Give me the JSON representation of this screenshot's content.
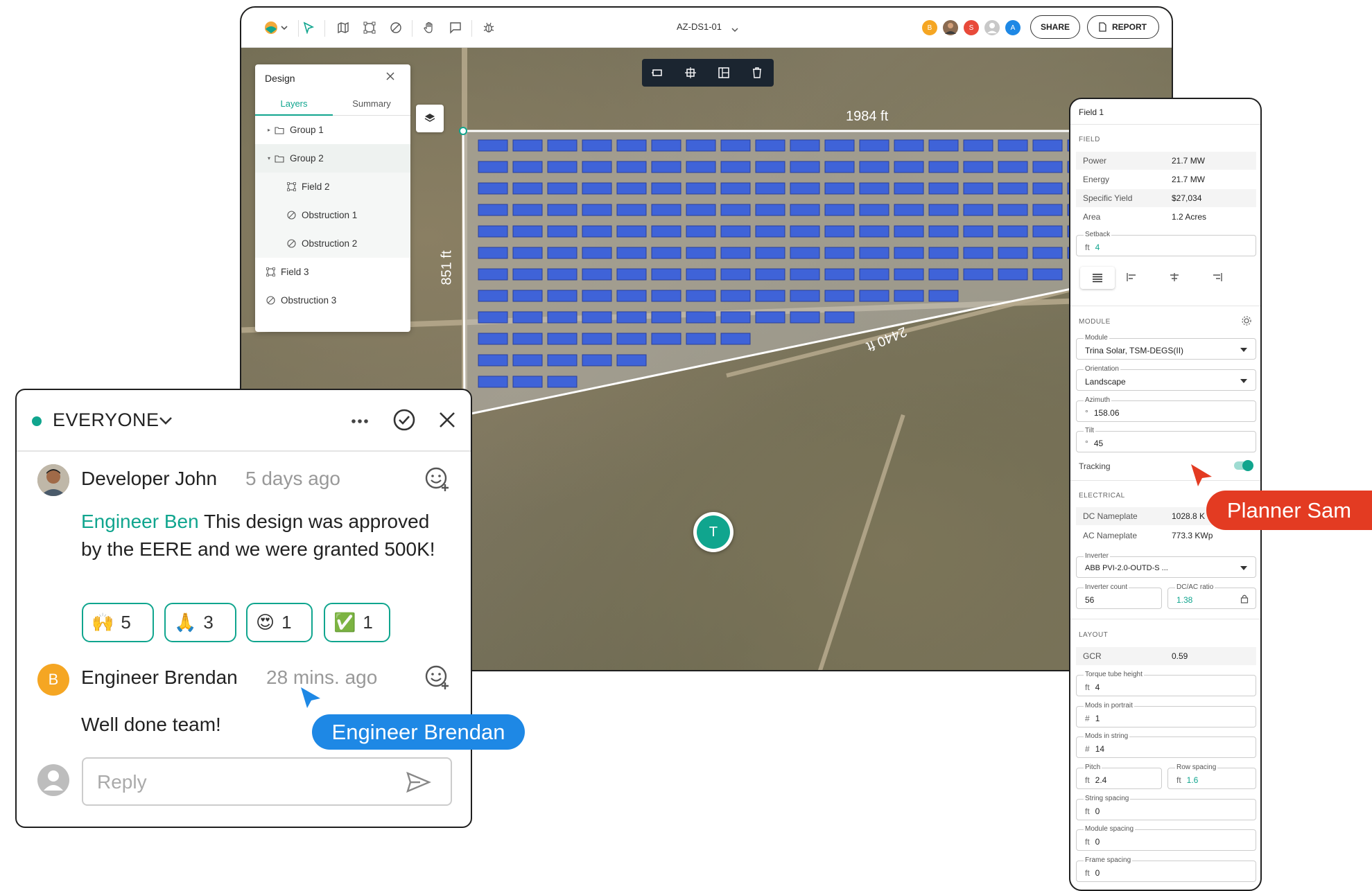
{
  "toolbar": {
    "project_name": "AZ-DS1-01",
    "share_label": "SHARE",
    "report_label": "REPORT",
    "avatars": [
      {
        "initial": "B",
        "color": "#f5a623"
      },
      {
        "initial": "",
        "color": "#8a6a50"
      },
      {
        "initial": "S",
        "color": "#e84a3a"
      },
      {
        "initial": "",
        "color": "#c8c8c8"
      },
      {
        "initial": "A",
        "color": "#1e88e5"
      }
    ]
  },
  "design_panel": {
    "title": "Design",
    "tabs": [
      "Layers",
      "Summary"
    ],
    "layers": [
      {
        "label": "Group 1",
        "type": "group-collapsed"
      },
      {
        "label": "Group 2",
        "type": "group-expanded"
      },
      {
        "label": "Field 2",
        "type": "field"
      },
      {
        "label": "Obstruction 1",
        "type": "obstruction"
      },
      {
        "label": "Obstruction 2",
        "type": "obstruction"
      },
      {
        "label": "Field 3",
        "type": "field"
      },
      {
        "label": "Obstruction 3",
        "type": "obstruction"
      }
    ]
  },
  "map": {
    "dim_top": "1984 ft",
    "dim_left": "851 ft",
    "dim_diag": "2440 ft",
    "marker_initial": "T"
  },
  "field_panel": {
    "title": "Field 1",
    "field_section": "FIELD",
    "field_rows": [
      {
        "k": "Power",
        "v": "21.7 MW"
      },
      {
        "k": "Energy",
        "v": "21.7 MW"
      },
      {
        "k": "Specific Yield",
        "v": "$27,034"
      },
      {
        "k": "Area",
        "v": "1.2 Acres"
      }
    ],
    "setback": {
      "label": "Setback",
      "unit": "ft",
      "value": "4"
    },
    "module_section": "MODULE",
    "module": {
      "label": "Module",
      "value": "Trina Solar, TSM-DEGS(II)"
    },
    "orientation": {
      "label": "Orientation",
      "value": "Landscape"
    },
    "azimuth": {
      "label": "Azimuth",
      "unit": "°",
      "value": "158.06"
    },
    "tilt": {
      "label": "Tilt",
      "unit": "°",
      "value": "45"
    },
    "tracking_label": "Tracking",
    "electrical_section": "ELECTRICAL",
    "electrical_rows": [
      {
        "k": "DC Nameplate",
        "v": "1028.8 K"
      },
      {
        "k": "AC Nameplate",
        "v": "773.3 KWp"
      }
    ],
    "inverter": {
      "label": "Inverter",
      "value": "ABB PVI-2.0-OUTD-S ..."
    },
    "inverter_count": {
      "label": "Inverter count",
      "value": "56"
    },
    "dcac_ratio": {
      "label": "DC/AC ratio",
      "value": "1.38"
    },
    "layout_section": "LAYOUT",
    "gcr": {
      "k": "GCR",
      "v": "0.59"
    },
    "torque_tube": {
      "label": "Torque tube height",
      "unit": "ft",
      "value": "4"
    },
    "mods_portrait": {
      "label": "Mods in portrait",
      "unit": "#",
      "value": "1"
    },
    "mods_string": {
      "label": "Mods in string",
      "unit": "#",
      "value": "14"
    },
    "pitch": {
      "label": "Pitch",
      "unit": "ft",
      "value": "2.4"
    },
    "row_spacing": {
      "label": "Row spacing",
      "unit": "ft",
      "value": "1.6"
    },
    "string_spacing": {
      "label": "String spacing",
      "unit": "ft",
      "value": "0"
    },
    "module_spacing": {
      "label": "Module spacing",
      "unit": "ft",
      "value": "0"
    },
    "frame_spacing": {
      "label": "Frame spacing",
      "unit": "ft",
      "value": "0"
    }
  },
  "comments": {
    "channel": "EVERYONE",
    "comment1": {
      "author": "Developer John",
      "time": "5 days ago",
      "mention": "Engineer Ben",
      "text": "This design was approved by the EERE and we were granted 500K!",
      "reactions": [
        {
          "emoji": "🙌",
          "count": "5"
        },
        {
          "emoji": "🙏",
          "count": "3"
        },
        {
          "emoji": "😍",
          "count": "1"
        },
        {
          "emoji": "✅",
          "count": "1"
        }
      ]
    },
    "comment2": {
      "author_initial": "B",
      "author": "Engineer Brendan",
      "time": "28 mins. ago",
      "text": "Well done team!"
    },
    "reply_placeholder": "Reply"
  },
  "cursors": {
    "planner": "Planner Sam",
    "engineer": "Engineer Brendan"
  },
  "colors": {
    "accent": "#10a58e",
    "panel_blue": "#3f63d8",
    "planner_red": "#e33b22",
    "engineer_blue": "#1e88e5"
  }
}
